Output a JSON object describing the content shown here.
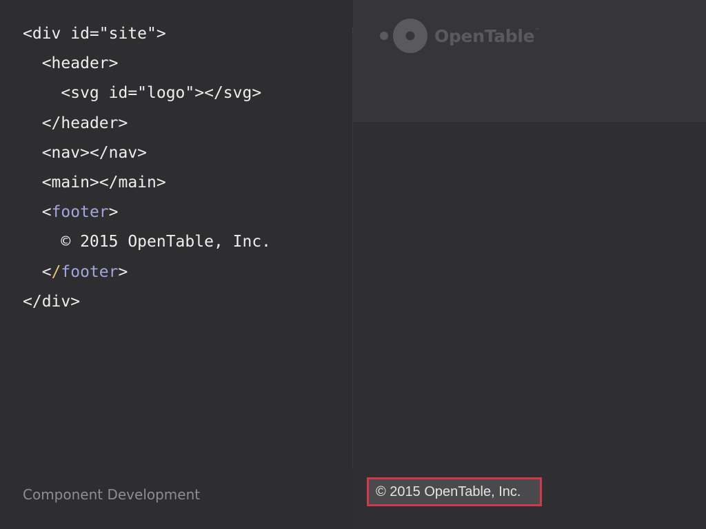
{
  "code_lines": [
    {
      "indent": "",
      "text": "<div id=\"site\">"
    },
    {
      "indent": "  ",
      "text": "<header>"
    },
    {
      "indent": "    ",
      "text": "<svg id=\"logo\"></svg>"
    },
    {
      "indent": "  ",
      "text": "</header>"
    },
    {
      "indent": "  ",
      "text": "<nav></nav>"
    },
    {
      "indent": "  ",
      "text": "<main></main>"
    },
    {
      "indent": "  ",
      "open": "<",
      "tag": "footer",
      "close": ">"
    },
    {
      "indent": "    ",
      "text": "© 2015 OpenTable, Inc."
    },
    {
      "indent": "  ",
      "open": "<",
      "slash": "/",
      "tag": "footer",
      "close": ">"
    },
    {
      "indent": "",
      "text": "</div>"
    }
  ],
  "slide_label": "Component Development",
  "preview": {
    "logo_text": "OpenTable",
    "logo_tm": "™",
    "copyright": "© 2015 OpenTable, Inc."
  },
  "colors": {
    "background": "#2e2e30",
    "code_text": "#eeeeee",
    "keyword_highlight": "#a3a6dc",
    "slash_highlight": "#e8c56a",
    "highlight_border": "#d2374a",
    "logo": "#5a5a5c"
  },
  "icons": {
    "logo": "opentable-logo-icon"
  }
}
